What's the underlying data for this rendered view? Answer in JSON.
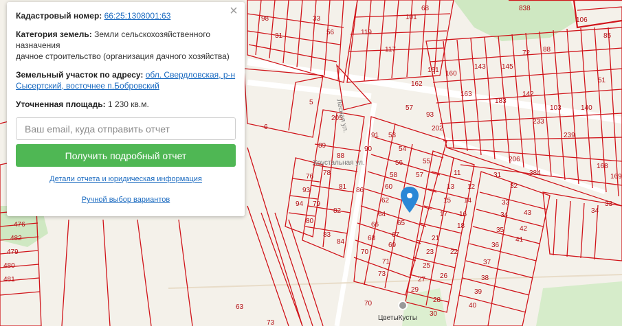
{
  "panel": {
    "close_label": "×",
    "cadastral_label": "Кадастровый номер:",
    "cadastral_number": "66:25:1308001:63",
    "category_label": "Категория земель:",
    "category_value_1": "Земли сельскохозяйственного назначения",
    "category_value_2": "дачное строительство (организация дачного хозяйства)",
    "address_label": "Земельный участок по адресу:",
    "address_value": "обл. Свердловская, р-н Сысертский, восточнее п.Бобровский",
    "area_label": "Уточненная площадь:",
    "area_value": "1 230 кв.м.",
    "email_placeholder": "Ваш email, куда отправить отчет",
    "email_value": "",
    "report_button": "Получить подробный отчет",
    "details_link": "Детали отчета и юридическая информация",
    "manual_link": "Ручной выбор вариантов"
  },
  "map": {
    "marker_icon": "map-pin-icon",
    "poi_icon": "poi-circle-icon",
    "poi_label": "ЦветыКусты",
    "road_labels": [
      "Лесная ул.",
      "Хрустальная ул."
    ],
    "plot_numbers": [
      "66:25:1308001:63"
    ],
    "colors": {
      "plot_stroke": "#d0141a",
      "marker": "#2a87d6",
      "forest": "#cfe8c2",
      "button": "#4fb754",
      "link": "#1a6ac0"
    }
  }
}
